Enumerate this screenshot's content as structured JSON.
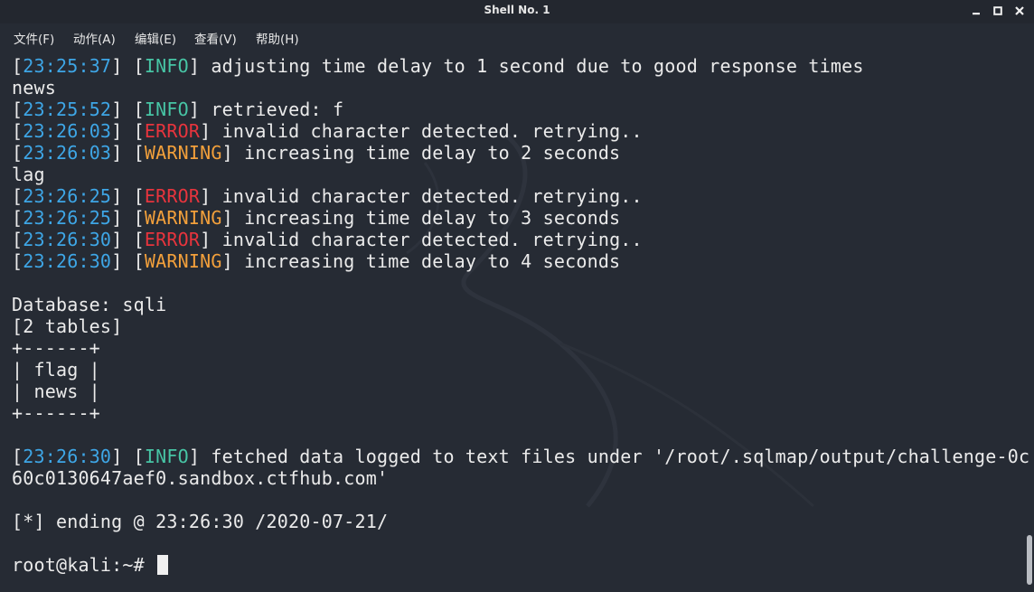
{
  "window": {
    "title": "Shell No. 1",
    "controls": [
      "minimize-icon",
      "maximize-icon",
      "close-icon"
    ]
  },
  "menu": [
    {
      "label": "文件(F)"
    },
    {
      "label": "动作(A)"
    },
    {
      "label": "编辑(E)"
    },
    {
      "label": "查看(V)"
    },
    {
      "label": "帮助(H)"
    }
  ],
  "terminal": {
    "lines": [
      {
        "ts": "23:25:37",
        "level": "INFO",
        "msg": " adjusting time delay to 1 second due to good response times"
      },
      {
        "text": "news"
      },
      {
        "ts": "23:25:52",
        "level": "INFO",
        "msg": " retrieved: f"
      },
      {
        "ts": "23:26:03",
        "level": "ERROR",
        "msg": " invalid character detected. retrying.."
      },
      {
        "ts": "23:26:03",
        "level": "WARNING",
        "msg": " increasing time delay to 2 seconds"
      },
      {
        "text": "lag"
      },
      {
        "ts": "23:26:25",
        "level": "ERROR",
        "msg": " invalid character detected. retrying.."
      },
      {
        "ts": "23:26:25",
        "level": "WARNING",
        "msg": " increasing time delay to 3 seconds"
      },
      {
        "ts": "23:26:30",
        "level": "ERROR",
        "msg": " invalid character detected. retrying.."
      },
      {
        "ts": "23:26:30",
        "level": "WARNING",
        "msg": " increasing time delay to 4 seconds"
      },
      {
        "text": ""
      },
      {
        "text": "Database: sqli"
      },
      {
        "text": "[2 tables]"
      },
      {
        "text": "+------+"
      },
      {
        "text": "| flag |"
      },
      {
        "text": "| news |"
      },
      {
        "text": "+------+"
      },
      {
        "text": ""
      },
      {
        "ts": "23:26:30",
        "level": "INFO",
        "msg": " fetched data logged to text files under '/root/.sqlmap/output/challenge-0c"
      },
      {
        "text": "60c0130647aef0.sandbox.ctfhub.com'"
      },
      {
        "text": ""
      },
      {
        "text": "[*] ending @ 23:26:30 /2020-07-21/"
      },
      {
        "text": ""
      }
    ],
    "prompt": "root@kali:~# ",
    "colors": {
      "timestamp": "#3ea6e6",
      "INFO": "#47c5a5",
      "ERROR": "#e8343d",
      "WARNING": "#f3a03b",
      "text": "#ebebeb",
      "background": "#262b34"
    }
  }
}
